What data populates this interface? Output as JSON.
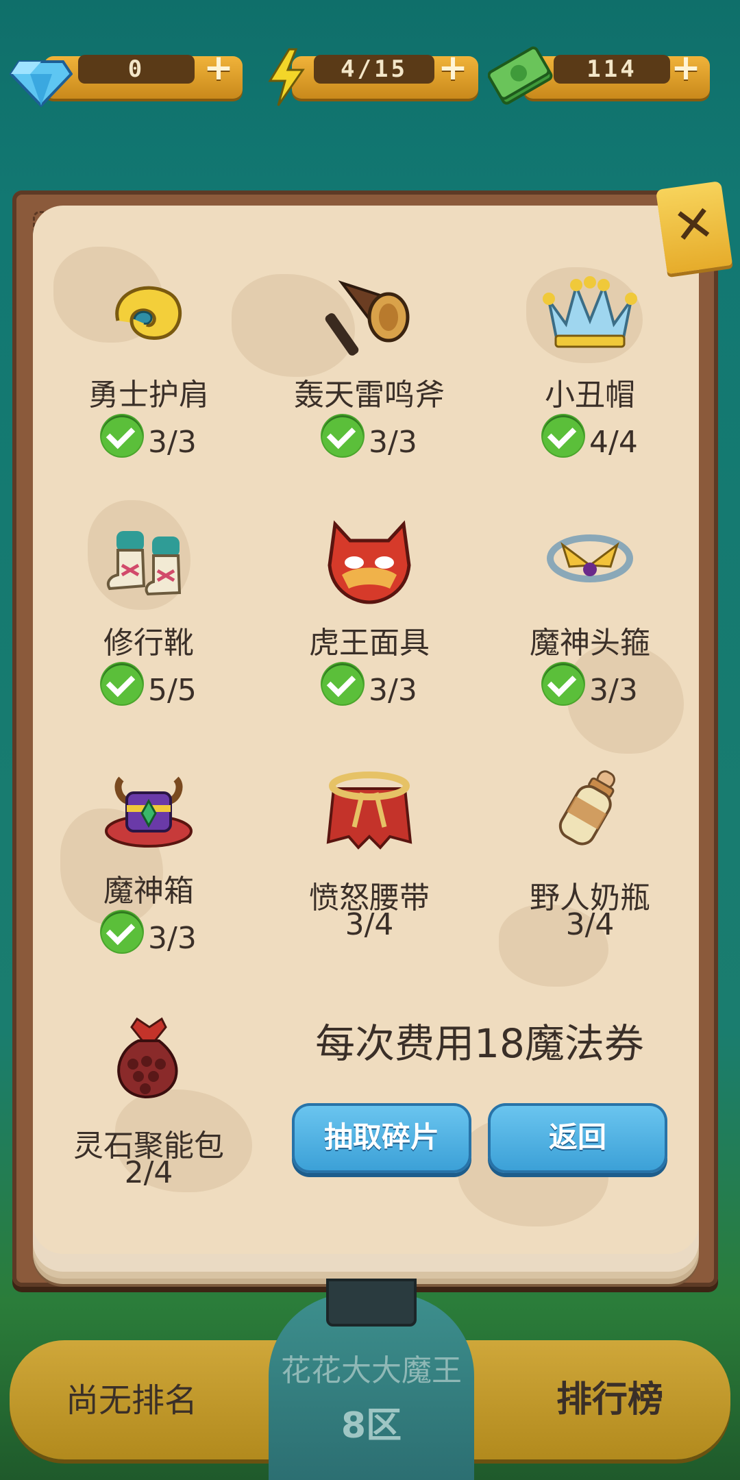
{
  "resources": {
    "gems": "0",
    "energy": "4/15",
    "cash": "114"
  },
  "items": [
    {
      "name": "勇士护肩",
      "progress": "3/3",
      "complete": true,
      "icon": "shoulder-pad-icon"
    },
    {
      "name": "轰天雷鸣斧",
      "progress": "3/3",
      "complete": true,
      "icon": "axe-icon"
    },
    {
      "name": "小丑帽",
      "progress": "4/4",
      "complete": true,
      "icon": "crown-icon"
    },
    {
      "name": "修行靴",
      "progress": "5/5",
      "complete": true,
      "icon": "boots-icon"
    },
    {
      "name": "虎王面具",
      "progress": "3/3",
      "complete": true,
      "icon": "tiger-mask-icon"
    },
    {
      "name": "魔神头箍",
      "progress": "3/3",
      "complete": true,
      "icon": "headband-icon"
    },
    {
      "name": "魔神箱",
      "progress": "3/3",
      "complete": true,
      "icon": "treasure-box-icon"
    },
    {
      "name": "愤怒腰带",
      "progress": "3/4",
      "complete": false,
      "icon": "belt-icon"
    },
    {
      "name": "野人奶瓶",
      "progress": "3/4",
      "complete": false,
      "icon": "milk-bottle-icon"
    },
    {
      "name": "灵石聚能包",
      "progress": "2/4",
      "complete": false,
      "icon": "spirit-bag-icon"
    }
  ],
  "cost_text": "每次费用18魔法券",
  "buttons": {
    "draw": "抽取碎片",
    "back": "返回"
  },
  "bottom": {
    "rank_text": "尚无排名",
    "player_name": "花花大大魔王",
    "zone": "8区",
    "leaderboard": "排行榜"
  }
}
